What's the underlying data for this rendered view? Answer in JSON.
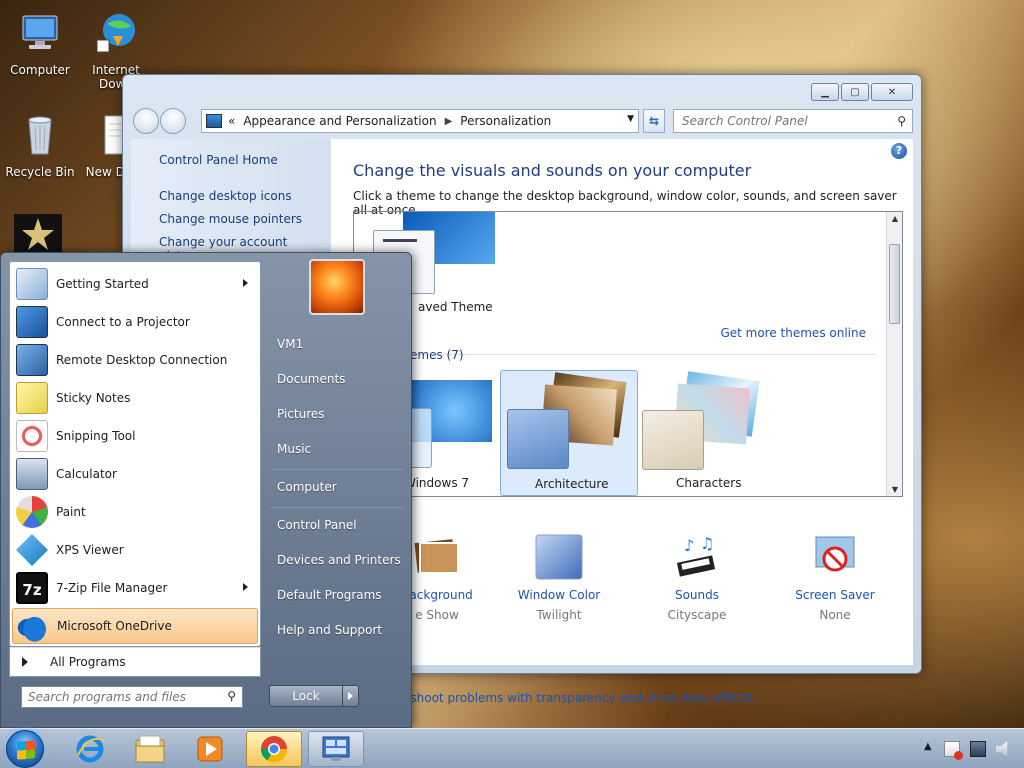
{
  "desktop": {
    "icons": [
      {
        "label": "Computer"
      },
      {
        "label": "Internet Down"
      },
      {
        "label": "Recycle Bin"
      },
      {
        "label": "New Docu"
      }
    ]
  },
  "control_panel": {
    "address": {
      "prefix": "«",
      "segments": [
        "Appearance and Personalization",
        "Personalization"
      ]
    },
    "search_placeholder": "Search Control Panel",
    "left_nav": {
      "home": "Control Panel Home",
      "links": [
        "Change desktop icons",
        "Change mouse pointers",
        "Change your account picture"
      ]
    },
    "heading": "Change the visuals and sounds on your computer",
    "subheading": "Click a theme to change the desktop background, window color, sounds, and screen saver all at once.",
    "my_themes": {
      "unsaved_label": "aved Theme",
      "get_more": "Get more themes online"
    },
    "aero_section_label": "emes (7)",
    "themes": [
      {
        "label": "Windows 7",
        "selected": false
      },
      {
        "label": "Architecture",
        "selected": true
      },
      {
        "label": "Characters",
        "selected": false
      }
    ],
    "bottom": [
      {
        "label": "Background",
        "sub": "e Show"
      },
      {
        "label": "Window Color",
        "sub": "Twilight"
      },
      {
        "label": "Sounds",
        "sub": "Cityscape"
      },
      {
        "label": "Screen Saver",
        "sub": "None"
      }
    ],
    "troubleshoot": "eshoot problems with transparency and other Aero effects"
  },
  "start_menu": {
    "programs": [
      {
        "label": "Getting Started",
        "submenu": true
      },
      {
        "label": "Connect to a Projector",
        "submenu": false
      },
      {
        "label": "Remote Desktop Connection",
        "submenu": false
      },
      {
        "label": "Sticky Notes",
        "submenu": false
      },
      {
        "label": "Snipping Tool",
        "submenu": false
      },
      {
        "label": "Calculator",
        "submenu": false
      },
      {
        "label": "Paint",
        "submenu": false
      },
      {
        "label": "XPS Viewer",
        "submenu": false
      },
      {
        "label": "7-Zip File Manager",
        "submenu": true
      },
      {
        "label": "Microsoft OneDrive",
        "submenu": false,
        "highlighted": true
      }
    ],
    "all_programs": "All Programs",
    "search_placeholder": "Search programs and files",
    "right_links": [
      "VM1",
      "Documents",
      "Pictures",
      "Music",
      "Computer",
      "Control Panel",
      "Devices and Printers",
      "Default Programs",
      "Help and Support"
    ],
    "lock_label": "Lock"
  },
  "colors": {
    "link_blue": "#1a55b0",
    "heading_blue": "#1e3e80",
    "highlight_orange": "#f8c78c"
  }
}
